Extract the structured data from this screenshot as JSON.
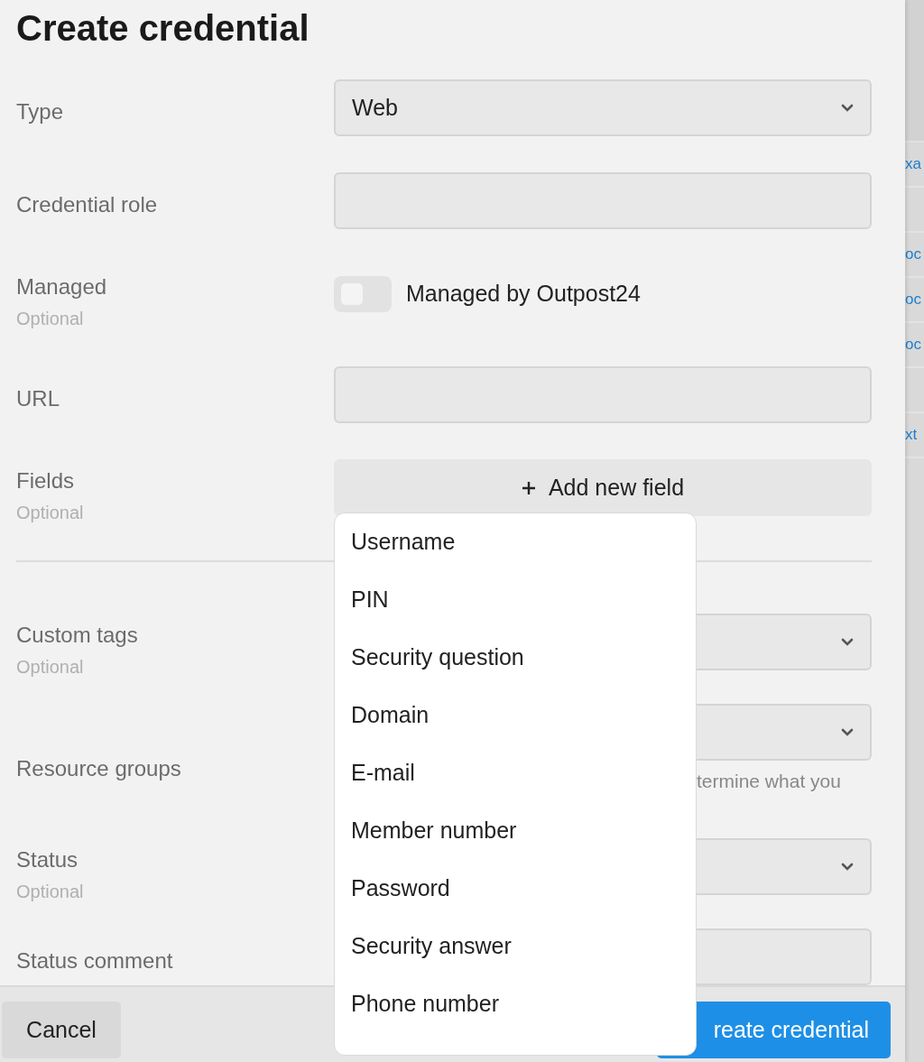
{
  "title": "Create credential",
  "sections": [
    {
      "rows": [
        {
          "kind": "select",
          "label": "Type",
          "value": "Web"
        },
        {
          "kind": "input",
          "label": "Credential role"
        },
        {
          "kind": "toggle",
          "label": "Managed",
          "hint": "Optional",
          "on": false,
          "toggle_label": "Managed by Outpost24"
        },
        {
          "kind": "input",
          "label": "URL"
        },
        {
          "kind": "button",
          "label": "Fields",
          "hint": "Optional",
          "button_label": "Add new field"
        }
      ]
    },
    {
      "rows": [
        {
          "kind": "select",
          "label": "Custom tags",
          "hint": "Optional"
        },
        {
          "kind": "select",
          "label": "Resource groups",
          "help": "termine what you"
        },
        {
          "kind": "select",
          "label": "Status",
          "hint": "Optional"
        },
        {
          "kind": "input",
          "label": "Status comment"
        }
      ]
    }
  ],
  "menu": {
    "items": [
      "Username",
      "PIN",
      "Security question",
      "Domain",
      "E-mail",
      "Member number",
      "Password",
      "Security answer",
      "Phone number"
    ]
  },
  "footer": {
    "cancel": "Cancel",
    "submit": "reate credential"
  },
  "background_links": [
    {
      "kind": "link",
      "text": "xa"
    },
    {
      "kind": "empty"
    },
    {
      "kind": "link",
      "text": "oc"
    },
    {
      "kind": "link",
      "text": "oc"
    },
    {
      "kind": "link",
      "text": "oc"
    },
    {
      "kind": "empty"
    },
    {
      "kind": "link",
      "text": "xt"
    }
  ]
}
